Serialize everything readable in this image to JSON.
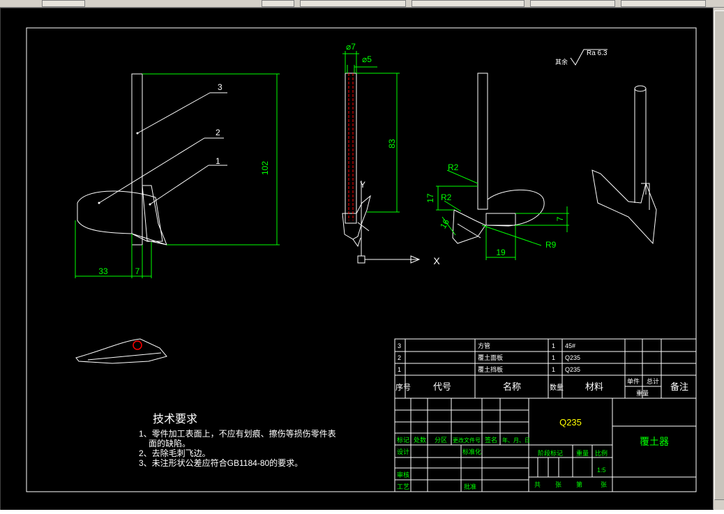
{
  "drawing": {
    "title_block": {
      "parts": [
        {
          "no": "3",
          "name": "方管",
          "qty": "1",
          "material": "45#"
        },
        {
          "no": "2",
          "name": "覆土面板",
          "qty": "1",
          "material": "Q235"
        },
        {
          "no": "1",
          "name": "覆土挡板",
          "qty": "1",
          "material": "Q235"
        }
      ],
      "header": {
        "no": "序号",
        "code": "代号",
        "name": "名称",
        "qty": "数量",
        "material": "材料",
        "single": "单件",
        "total": "总计",
        "weight": "重量",
        "remark": "备注"
      },
      "material_big": "Q235",
      "part_name": "覆土器",
      "rev_row": [
        "标记",
        "处数",
        "分区",
        "更改文件号",
        "签名",
        "年、月、日"
      ],
      "design": "设计",
      "standardize": "标准化",
      "stage": "阶段标记",
      "weight_label": "重量",
      "scale_label": "比例",
      "scale": "1:5",
      "check": "审核",
      "process": "工艺",
      "approve": "批准",
      "sheets": [
        "共",
        "张",
        "第",
        "张"
      ]
    },
    "tech_req": {
      "title": "技术要求",
      "lines": [
        "1、零件加工表面上，不应有划痕、擦伤等损伤零件表",
        "面的缺陷。",
        "2、去除毛刺飞边。",
        "3、未注形状公差应符合GB1184-80的要求。"
      ]
    },
    "dims": {
      "d102": "102",
      "d33": "33",
      "d7a": "7",
      "phi7": "⌀7",
      "phi5": "⌀5",
      "d83": "83",
      "r2a": "R2",
      "r2b": "R2",
      "d17": "17",
      "d16": "16",
      "d19": "19",
      "d7b": "7",
      "r9": "R9",
      "roughness": "Ra 6.3",
      "roughness_prefix": "其余",
      "callouts": [
        "3",
        "2",
        "1"
      ],
      "axis_x": "X",
      "axis_y": "Y"
    }
  },
  "colors": {
    "background": "#000000",
    "line": "#ffffff",
    "dimension": "#00ff00",
    "title_text": "#ffff00",
    "frame": "#ffffff"
  }
}
